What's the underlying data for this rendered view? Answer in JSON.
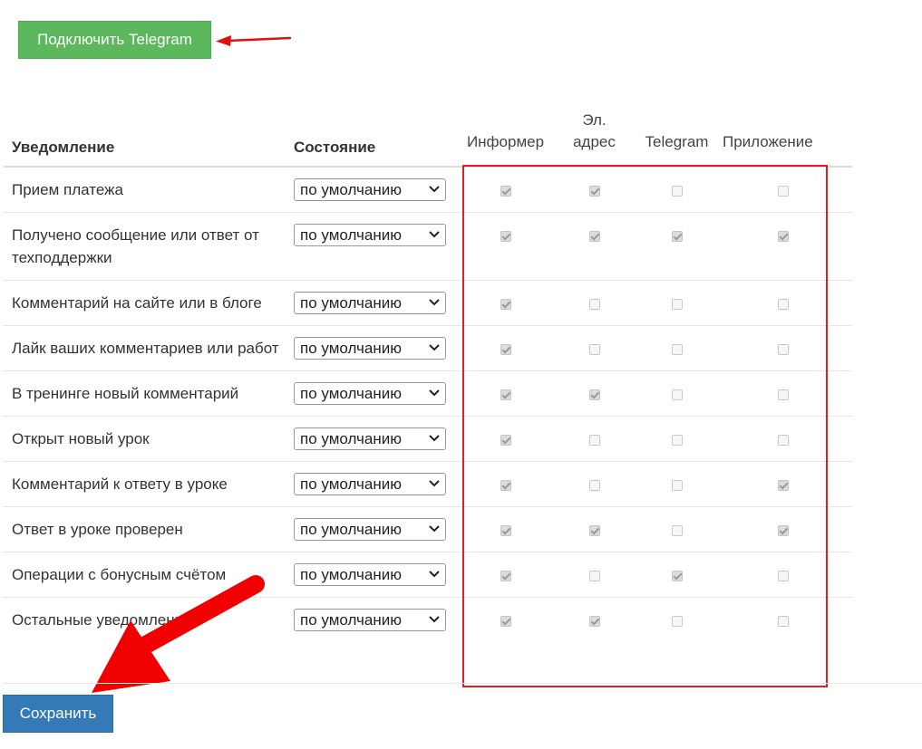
{
  "connect_button": "Подключить Telegram",
  "table": {
    "headers": {
      "notification": "Уведомление",
      "state": "Состояние",
      "informer": "Информер",
      "email_line1": "Эл.",
      "email_line2": "адрес",
      "telegram": "Telegram",
      "app": "Приложение"
    },
    "rows": [
      {
        "label": "Прием платежа",
        "state": "по умолчанию",
        "checks": [
          true,
          true,
          false,
          false
        ]
      },
      {
        "label": "Получено сообщение или ответ от техподдержки",
        "state": "по умолчанию",
        "checks": [
          true,
          true,
          true,
          true
        ]
      },
      {
        "label": "Комментарий на сайте или в блоге",
        "state": "по умолчанию",
        "checks": [
          true,
          false,
          false,
          false
        ]
      },
      {
        "label": "Лайк ваших комментариев или работ",
        "state": "по умолчанию",
        "checks": [
          true,
          false,
          false,
          false
        ]
      },
      {
        "label": "В тренинге новый комментарий",
        "state": "по умолчанию",
        "checks": [
          true,
          true,
          false,
          false
        ]
      },
      {
        "label": "Открыт новый урок",
        "state": "по умолчанию",
        "checks": [
          true,
          false,
          false,
          false
        ]
      },
      {
        "label": "Комментарий к ответу в уроке",
        "state": "по умолчанию",
        "checks": [
          true,
          false,
          false,
          true
        ]
      },
      {
        "label": "Ответ в уроке проверен",
        "state": "по умолчанию",
        "checks": [
          true,
          true,
          false,
          true
        ]
      },
      {
        "label": "Операции с бонусным счётом",
        "state": "по умолчанию",
        "checks": [
          true,
          false,
          true,
          false
        ]
      },
      {
        "label": "Остальные уведомления",
        "state": "по умолчанию",
        "checks": [
          true,
          true,
          false,
          false
        ]
      }
    ]
  },
  "save_button": "Сохранить",
  "colors": {
    "connect_green": "#5cb85c",
    "save_blue": "#337ab7",
    "highlight_red": "#e02020"
  }
}
